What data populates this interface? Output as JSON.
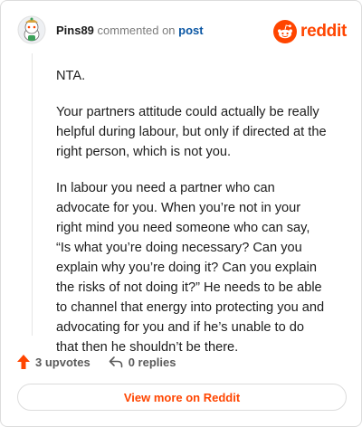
{
  "header": {
    "username": "Pins89",
    "verb": "commented on",
    "post_link": "post",
    "brand": "reddit"
  },
  "comment": {
    "paragraphs": [
      "NTA.",
      "Your partners attitude could actually be really helpful during labour, but only if directed at the right person, which is not you.",
      "In labour you need a partner who can advocate for you. When you’re not in your right mind you need someone who can say, “Is what you’re doing necessary? Can you explain why you’re doing it? Can you explain the risks of not doing it?” He needs to be able to channel that energy into protecting you and advocating for you and if he’s unable to do that then he shouldn’t be there."
    ]
  },
  "actions": {
    "upvotes": "3 upvotes",
    "replies": "0 replies"
  },
  "footer": {
    "view_more": "View more on Reddit"
  },
  "colors": {
    "brand": "#ff4500",
    "link": "#0b57a4"
  },
  "icons": [
    "avatar-snoo",
    "reddit-logo-icon",
    "upvote-arrow-icon",
    "reply-arrow-icon"
  ]
}
